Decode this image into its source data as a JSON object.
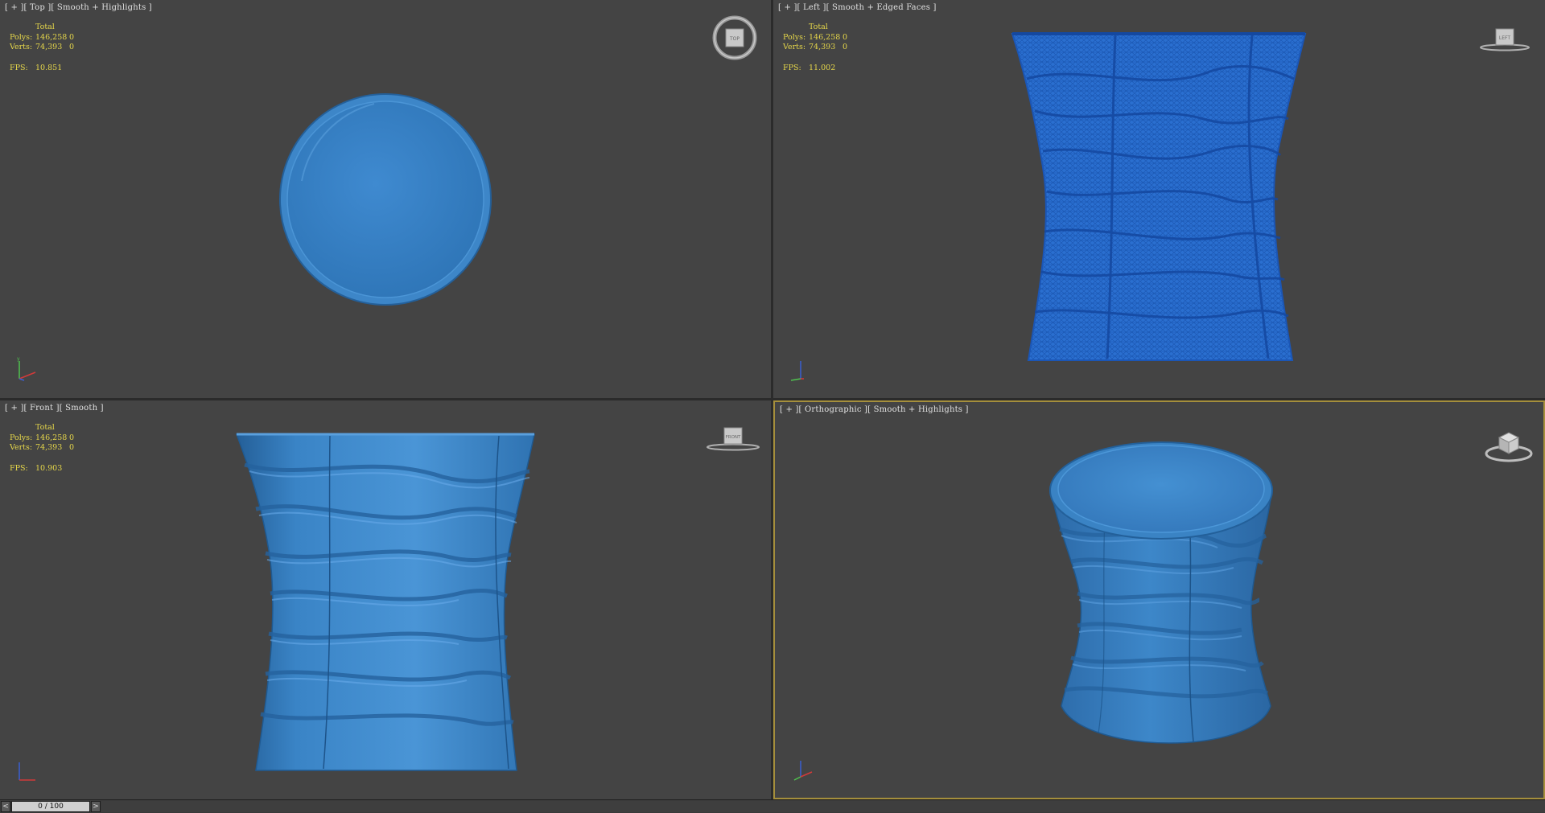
{
  "viewports": {
    "top": {
      "label": "[ + ][ Top ][ Smooth + Highlights ]",
      "navcube_label": "TOP"
    },
    "left": {
      "label": "[ + ][ Left ][ Smooth + Edged Faces ]",
      "navcube_label": "LEFT"
    },
    "front": {
      "label": "[ + ][ Front ][ Smooth ]",
      "navcube_label": "FRONT"
    },
    "ortho": {
      "label": "[ + ][ Orthographic ][ Smooth + Highlights ]"
    }
  },
  "stats": {
    "top": {
      "total_header": "Total",
      "polys_label": "Polys:",
      "polys_value": "146,258",
      "polys_sel": "0",
      "verts_label": "Verts:",
      "verts_value": "74,393",
      "verts_sel": "0",
      "fps_label": "FPS:",
      "fps_value": "10.851"
    },
    "left": {
      "total_header": "Total",
      "polys_label": "Polys:",
      "polys_value": "146,258",
      "polys_sel": "0",
      "verts_label": "Verts:",
      "verts_value": "74,393",
      "verts_sel": "0",
      "fps_label": "FPS:",
      "fps_value": "11.002"
    },
    "front": {
      "total_header": "Total",
      "polys_label": "Polys:",
      "polys_value": "146,258",
      "polys_sel": "0",
      "verts_label": "Verts:",
      "verts_value": "74,393",
      "verts_sel": "0",
      "fps_label": "FPS:",
      "fps_value": "10.903"
    }
  },
  "timeline": {
    "prev_label": "<",
    "next_label": ">",
    "frame_readout": "0 / 100"
  },
  "colors": {
    "viewport_bg": "#444444",
    "model_blue": "#3a83c4",
    "wire_blue": "#1f5fbf",
    "active_border": "#a58f3c",
    "stats_text": "#e6d74a"
  }
}
